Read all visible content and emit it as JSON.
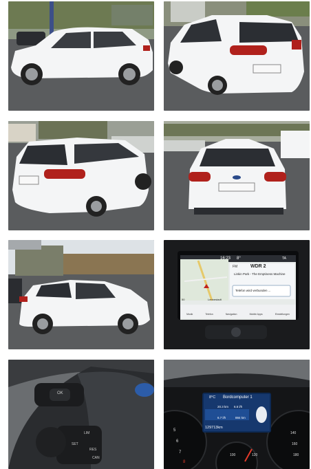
{
  "gallery": {
    "photos": [
      {
        "subject": "side-left-front"
      },
      {
        "subject": "rear-right"
      },
      {
        "subject": "rear-left"
      },
      {
        "subject": "rear"
      },
      {
        "subject": "side-left"
      },
      {
        "subject": "infotainment"
      },
      {
        "subject": "steering-wheel"
      },
      {
        "subject": "instrument-cluster"
      }
    ],
    "colors": {
      "car_body": "#f4f5f6",
      "asphalt": "#5c5e60",
      "sky": "#e8ecef",
      "foliage": "#5a6a3c",
      "tail_light": "#b0211c",
      "screen_blue": "#3aa0e8",
      "dashboard": "#1a1b1d"
    }
  },
  "infotainment": {
    "clock": "16:23",
    "temp": "8°",
    "ta_label": "TA",
    "station": "WDR 2",
    "fm_label": "FM",
    "track": "Linkin Park - The Emptiness Machine",
    "phone_status": "Telefon wird verbunden ...",
    "map_scale": "50",
    "map_place": "Lennestadt",
    "nav_items": [
      "Musik",
      "Telefon",
      "Navigation",
      "Mobile Apps",
      "Einstellungen"
    ]
  },
  "cluster": {
    "temp": "8°C",
    "title": "Bordcomputer 1",
    "range_1": "20.3 km",
    "range_2": "6.5 l/h",
    "consumption_1": "6.7 l/h",
    "consumption_2": "884 km",
    "odometer": "129713km",
    "speed_labels": [
      "5",
      "6",
      "7",
      "8"
    ],
    "kmh_labels": [
      "100",
      "120",
      "140",
      "160",
      "180"
    ]
  },
  "steering": {
    "ok_label": "OK",
    "lim_label": "LIM",
    "res_label": "RES",
    "set_label": "SET",
    "can_label": "CAN"
  }
}
